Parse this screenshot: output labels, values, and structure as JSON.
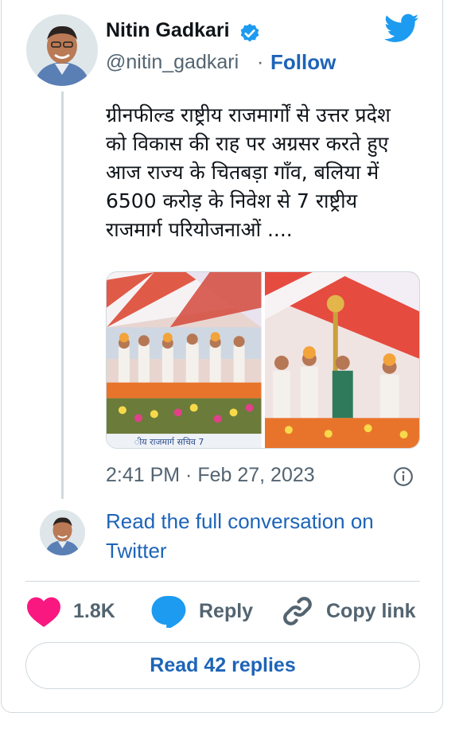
{
  "author": {
    "name": "Nitin Gadkari",
    "handle": "@nitin_gadkari",
    "separator": "·",
    "follow_label": "Follow"
  },
  "tweet": {
    "text": "ग्रीनफील्ड राष्ट्रीय राजमार्गों से उत्तर प्रदेश\nको विकास की राह पर अग्रसर करते हुए\nआज राज्य के चितबड़ा गाँव, बलिया में\n6500 करोड़ के निवेश से 7 राष्ट्रीय\nराजमार्ग परियोजनाओं ....",
    "timestamp": "2:41 PM · Feb 27, 2023",
    "media_caption_fragment": "ीय राजमार्ग सचिव 7"
  },
  "conversation": {
    "link_text": "Read the full conversation on Twitter"
  },
  "actions": {
    "likes_count": "1.8K",
    "reply_label": "Reply",
    "copy_link_label": "Copy link"
  },
  "footer": {
    "read_replies_label": "Read 42 replies"
  },
  "colors": {
    "brand_blue": "#1d9bf0",
    "link_blue": "#1d64b8",
    "like_pink": "#f91880",
    "secondary_text": "#536471",
    "border": "#cfd9de"
  },
  "icons": [
    "twitter-bird-icon",
    "verified-badge-icon",
    "info-icon",
    "heart-icon",
    "reply-bubble-icon",
    "link-icon"
  ]
}
